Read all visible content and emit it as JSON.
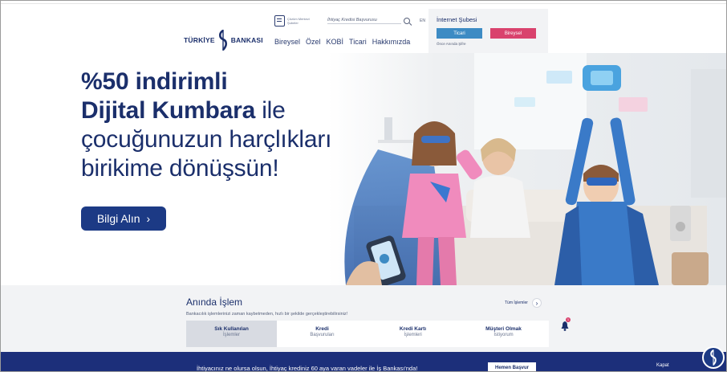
{
  "header": {
    "logo_left": "TÜRKİYE",
    "logo_right": "BANKASI",
    "call_center_label": "Çözüm Merkezi Şubeler",
    "search_placeholder": "İhtiyaç Kredisi Başvurusu",
    "lang": "EN",
    "nav": [
      "Bireysel",
      "Özel",
      "KOBİ",
      "Ticari",
      "Hakkımızda"
    ]
  },
  "internet_banking": {
    "title": "İnternet Şubesi",
    "ticari": "Ticari",
    "bireysel": "Bireysel",
    "link": "Önce Anında Şifre"
  },
  "hero": {
    "line1": "%50 indirimli",
    "line2_bold": "Dijital Kumbara",
    "line2_rest": " ile",
    "line3": "çocuğunuzun harçlıkları",
    "line4": "birikime dönüşsün!",
    "button": "Bilgi Alın",
    "button_arrow": "›"
  },
  "quick": {
    "title": "Anında İşlem",
    "subtitle": "Bankacılık işlemlerinizi zaman kaybetmeden, hızlı bir şekilde gerçekleştirebilirsiniz!",
    "all_link": "Tüm İşlemler",
    "tabs": [
      {
        "t1": "Sık Kullanılan",
        "t2": "İşlemler"
      },
      {
        "t1": "Kredi",
        "t2": "Başvuruları"
      },
      {
        "t1": "Kredi Kartı",
        "t2": "İşlemleri"
      },
      {
        "t1": "Müşteri Olmak",
        "t2": "İstiyorum"
      }
    ],
    "bell_count": "1"
  },
  "bottom": {
    "text": "İhtiyacınız ne olursa olsun, İhtiyaç krediniz 60 aya varan vadeler ile İş Bankası'nda!",
    "button": "Hemen Başvur",
    "close": "Kapat"
  },
  "colors": {
    "navy": "#1b2f6b",
    "ticari": "#3d8bc4",
    "bireysel": "#d9426d",
    "bar": "#1c2f7a"
  }
}
